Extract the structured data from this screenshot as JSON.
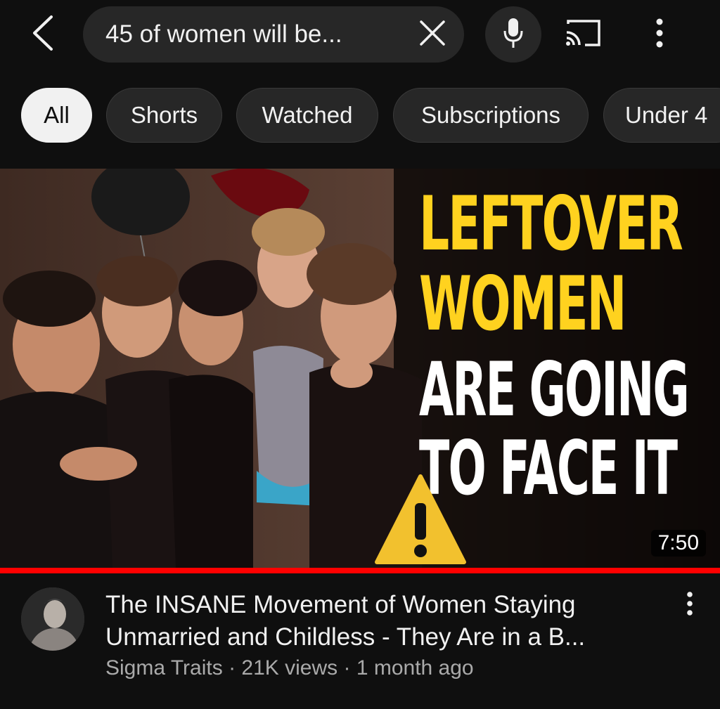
{
  "topbar": {
    "back_icon": "chevron-left-icon",
    "search_query": "45 of women will be...",
    "clear_icon": "close-icon",
    "mic_icon": "microphone-icon",
    "cast_icon": "cast-icon",
    "more_icon": "vertical-ellipsis-icon"
  },
  "chips": [
    {
      "label": "All",
      "active": true
    },
    {
      "label": "Shorts",
      "active": false
    },
    {
      "label": "Watched",
      "active": false
    },
    {
      "label": "Subscriptions",
      "active": false
    },
    {
      "label": "Under 4",
      "active": false
    }
  ],
  "video": {
    "thumbnail_text": {
      "line1": "LEFTOVER",
      "line2": "WOMEN",
      "line3": "ARE GOING",
      "line4": "TO FACE IT"
    },
    "warning_icon": "warning-triangle-icon",
    "duration": "7:50",
    "watched_fraction": 1.0,
    "title": "The INSANE Movement of Women Staying Unmarried and Childless - They Are in a B...",
    "channel": "Sigma Traits",
    "views": "21K views",
    "age": "1 month ago",
    "separator": "·"
  },
  "colors": {
    "background": "#0f0f0f",
    "surface": "#272727",
    "text_primary": "#f1f1f1",
    "text_secondary": "#aaaaaa",
    "progress_red": "#ff0000",
    "thumbnail_yellow": "#ffd21f",
    "thumbnail_white": "#ffffff"
  }
}
